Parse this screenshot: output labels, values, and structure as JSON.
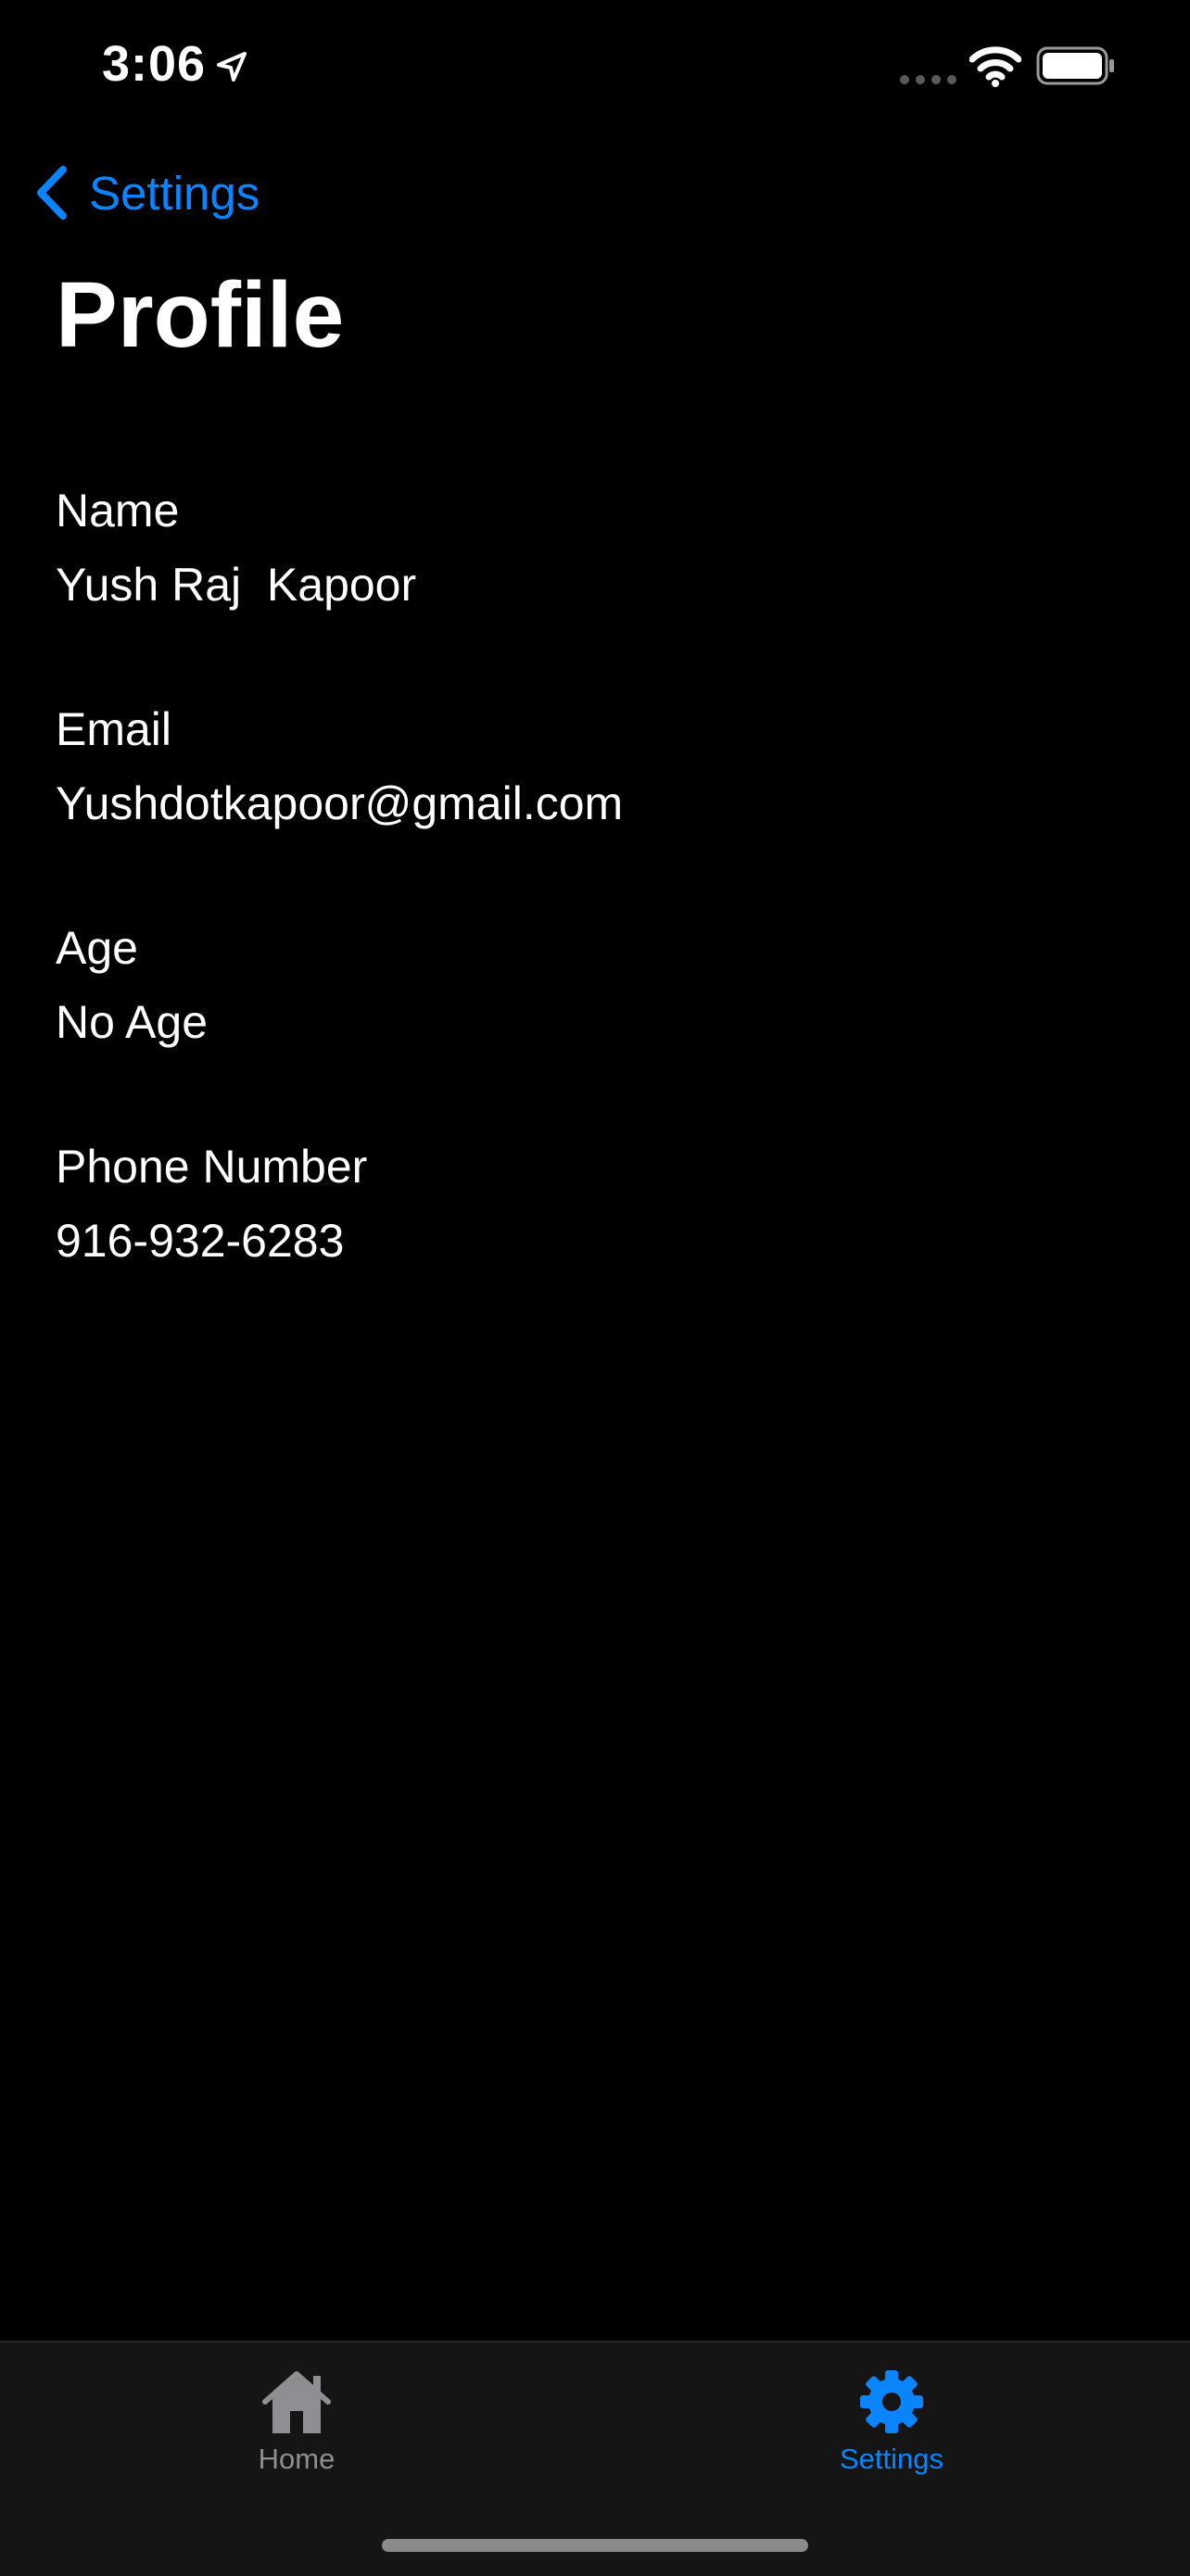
{
  "status_bar": {
    "time": "3:06",
    "icons": [
      "location-arrow-icon",
      "signal-dots-icon",
      "wifi-icon",
      "battery-icon"
    ]
  },
  "nav": {
    "back_label": "Settings",
    "back_icon": "chevron-left-icon",
    "title": "Profile"
  },
  "profile": {
    "fields": [
      {
        "label": "Name",
        "value": "Yush Raj  Kapoor"
      },
      {
        "label": "Email",
        "value": "Yushdotkapoor@gmail.com"
      },
      {
        "label": "Age",
        "value": "No Age"
      },
      {
        "label": "Phone Number",
        "value": "916-932-6283"
      }
    ]
  },
  "tab_bar": {
    "tabs": [
      {
        "label": "Home",
        "icon": "house-icon",
        "selected": false
      },
      {
        "label": "Settings",
        "icon": "gear-icon",
        "selected": true
      }
    ]
  },
  "colors": {
    "background": "#000000",
    "accent": "#0a84ff",
    "text": "#ffffff",
    "tab_inactive": "#8e8e93",
    "tab_bar_bg": "#151515"
  }
}
